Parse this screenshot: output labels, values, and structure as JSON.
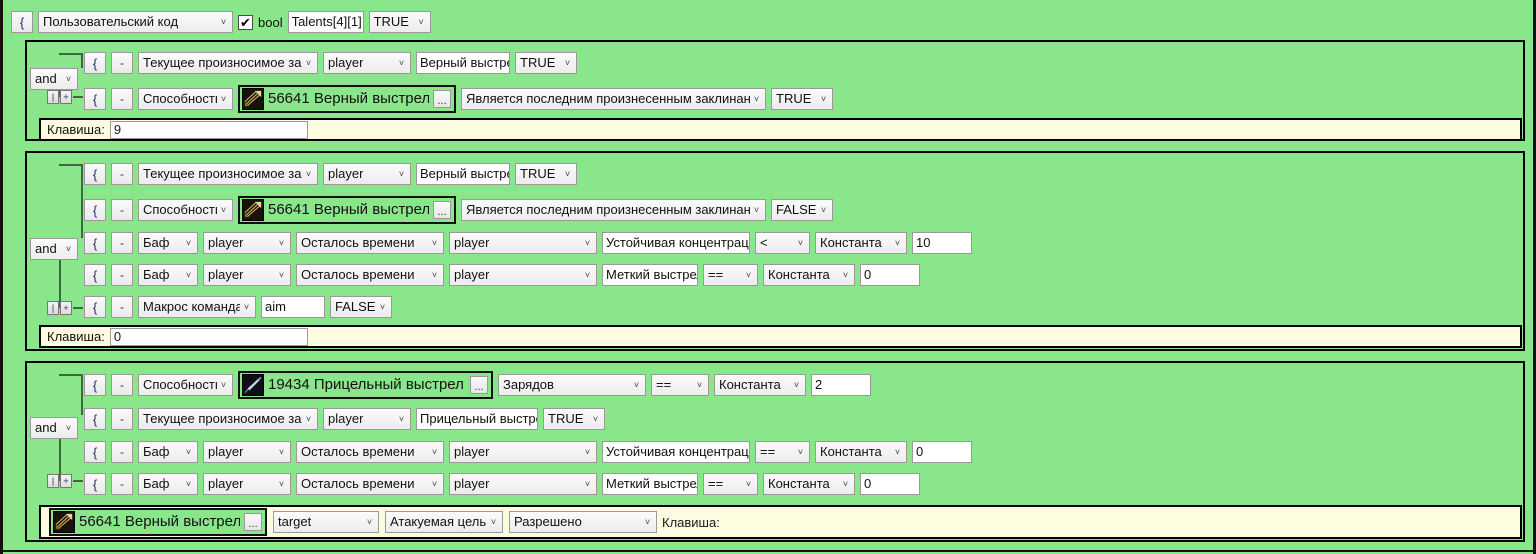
{
  "app": {
    "bg_color": "#8ae68a",
    "key_row_color": "#fdfbe0"
  },
  "header": {
    "brace": "{",
    "type_combo": "Пользовательский код",
    "checkbox_checked": true,
    "checkbox_mark": "✔",
    "type_label": "bool",
    "variable": "Talents[4][1]",
    "value_combo": "TRUE"
  },
  "blocks": [
    {
      "logic_operator": "and",
      "rows": [
        {
          "brace": "{",
          "minus": "-",
          "condition": "Текущее произносимое заклинание",
          "unit": "player",
          "value_text": "Верный выстрел",
          "bool_combo": "TRUE"
        },
        {
          "brace": "{",
          "minus": "-",
          "condition": "Способность",
          "spell_id": "56641",
          "spell_name": "Верный выстрел",
          "spell_icon": "steady-shot-icon",
          "ellipsis": "...",
          "property": "Является последним произнесенным заклинанием",
          "bool_combo": "TRUE"
        }
      ],
      "key_label": "Клавиша:",
      "key_value": "9"
    },
    {
      "logic_operator": "and",
      "rows": [
        {
          "brace": "{",
          "minus": "-",
          "condition": "Текущее произносимое заклинание",
          "unit": "player",
          "value_text": "Верный выстрел",
          "bool_combo": "TRUE"
        },
        {
          "brace": "{",
          "minus": "-",
          "condition": "Способность",
          "spell_id": "56641",
          "spell_name": "Верный выстрел",
          "spell_icon": "steady-shot-icon",
          "ellipsis": "...",
          "property": "Является последним произнесенным заклинанием",
          "bool_combo": "FALSE"
        },
        {
          "brace": "{",
          "minus": "-",
          "condition": "Баф",
          "unit": "player",
          "attribute": "Осталось времени",
          "unit2": "player",
          "buff_name": "Устойчивая концентрация",
          "operator": "<",
          "operand_type": "Константа",
          "operand_value": "10"
        },
        {
          "brace": "{",
          "minus": "-",
          "condition": "Баф",
          "unit": "player",
          "attribute": "Осталось времени",
          "unit2": "player",
          "buff_name": "Меткий выстрел",
          "operator": "==",
          "operand_type": "Константа",
          "operand_value": "0"
        },
        {
          "brace": "{",
          "minus": "-",
          "condition": "Макрос команда",
          "macro_text": "aim",
          "bool_combo": "FALSE"
        }
      ],
      "key_label": "Клавиша:",
      "key_value": "0"
    },
    {
      "logic_operator": "and",
      "rows": [
        {
          "brace": "{",
          "minus": "-",
          "condition": "Способность",
          "spell_id": "19434",
          "spell_name": "Прицельный выстрел",
          "spell_icon": "aimed-shot-icon",
          "ellipsis": "...",
          "property": "Зарядов",
          "operator": "==",
          "operand_type": "Константа",
          "operand_value": "2"
        },
        {
          "brace": "{",
          "minus": "-",
          "condition": "Текущее произносимое заклинание",
          "unit": "player",
          "value_text": "Прицельный выстрел",
          "bool_combo": "TRUE"
        },
        {
          "brace": "{",
          "minus": "-",
          "condition": "Баф",
          "unit": "player",
          "attribute": "Осталось времени",
          "unit2": "player",
          "buff_name": "Устойчивая концентрация",
          "operator": "==",
          "operand_type": "Константа",
          "operand_value": "0"
        },
        {
          "brace": "{",
          "minus": "-",
          "condition": "Баф",
          "unit": "player",
          "attribute": "Осталось времени",
          "unit2": "player",
          "buff_name": "Меткий выстрел",
          "operator": "==",
          "operand_type": "Константа",
          "operand_value": "0"
        }
      ],
      "action": {
        "spell_id": "56641",
        "spell_name": "Верный выстрел",
        "spell_icon": "steady-shot-icon",
        "ellipsis": "...",
        "target": "target",
        "target_type": "Атакуемая цель",
        "permission": "Разрешено",
        "key_label": "Клавиша:",
        "key_value": ""
      }
    }
  ],
  "icons": {
    "dropdown_arrow": "˅",
    "tree_collapse": "|",
    "tree_expand": "+"
  }
}
